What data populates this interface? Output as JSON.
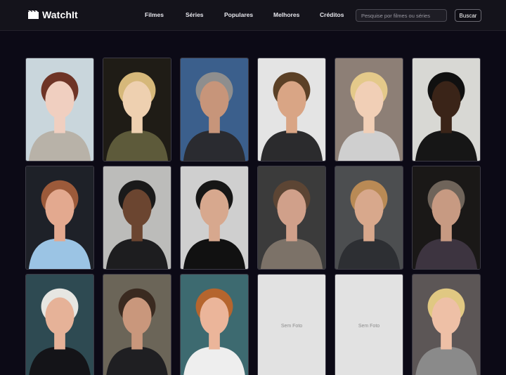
{
  "header": {
    "logo_text": "WatchIt",
    "nav": [
      "Filmes",
      "Séries",
      "Populares",
      "Melhores",
      "Créditos"
    ],
    "search_placeholder": "Pesquise por filmes ou séries",
    "search_button": "Buscar"
  },
  "cast": [
    {
      "photo": true,
      "bg": "#c9d6dc",
      "skin": "#f0cfc0",
      "hair": "#6e3426",
      "shirt": "#b8b2a8"
    },
    {
      "photo": true,
      "bg": "#1f1c16",
      "skin": "#eed0b0",
      "hair": "#d6b87a",
      "shirt": "#5d5a3a"
    },
    {
      "photo": true,
      "bg": "#3b5f8c",
      "skin": "#c7957a",
      "hair": "#8e8e8e",
      "shirt": "#2a2b30"
    },
    {
      "photo": true,
      "bg": "#e4e4e4",
      "skin": "#d9a585",
      "hair": "#5b4026",
      "shirt": "#2b2b2d"
    },
    {
      "photo": true,
      "bg": "#8d7f76",
      "skin": "#f1cfb6",
      "hair": "#e4c98a",
      "shirt": "#cfcfcf"
    },
    {
      "photo": true,
      "bg": "#d8d8d4",
      "skin": "#3a2418",
      "hair": "#101010",
      "shirt": "#161616"
    },
    {
      "photo": true,
      "bg": "#1e2128",
      "skin": "#e3a98f",
      "hair": "#9c5a3a",
      "shirt": "#9bc4e4"
    },
    {
      "photo": true,
      "bg": "#bcbcba",
      "skin": "#6b4530",
      "hair": "#1a1a1a",
      "shirt": "#1d1d1f"
    },
    {
      "photo": true,
      "bg": "#cfcfcf",
      "skin": "#d7a88e",
      "hair": "#161616",
      "shirt": "#111111"
    },
    {
      "photo": true,
      "bg": "#3b3b3b",
      "skin": "#d0a08a",
      "hair": "#5c4534",
      "shirt": "#7c7268"
    },
    {
      "photo": true,
      "bg": "#4c4e50",
      "skin": "#d8a88c",
      "hair": "#b98a55",
      "shirt": "#2d2f33"
    },
    {
      "photo": true,
      "bg": "#1a1817",
      "skin": "#c79a82",
      "hair": "#6f645a",
      "shirt": "#3d3440"
    },
    {
      "photo": true,
      "bg": "#2e4a52",
      "skin": "#e6b298",
      "hair": "#e6e6e2",
      "shirt": "#141418"
    },
    {
      "photo": true,
      "bg": "#6b6558",
      "skin": "#c9977c",
      "hair": "#3a2a20",
      "shirt": "#1f1f22"
    },
    {
      "photo": true,
      "bg": "#3d6a70",
      "skin": "#ebb59a",
      "hair": "#b5652e",
      "shirt": "#eeeeee"
    },
    {
      "photo": false,
      "label": "Sem Foto"
    },
    {
      "photo": false,
      "label": "Sem Foto"
    },
    {
      "photo": true,
      "bg": "#5c5656",
      "skin": "#eec0a6",
      "hair": "#e0c882",
      "shirt": "#8a8a8a"
    }
  ]
}
